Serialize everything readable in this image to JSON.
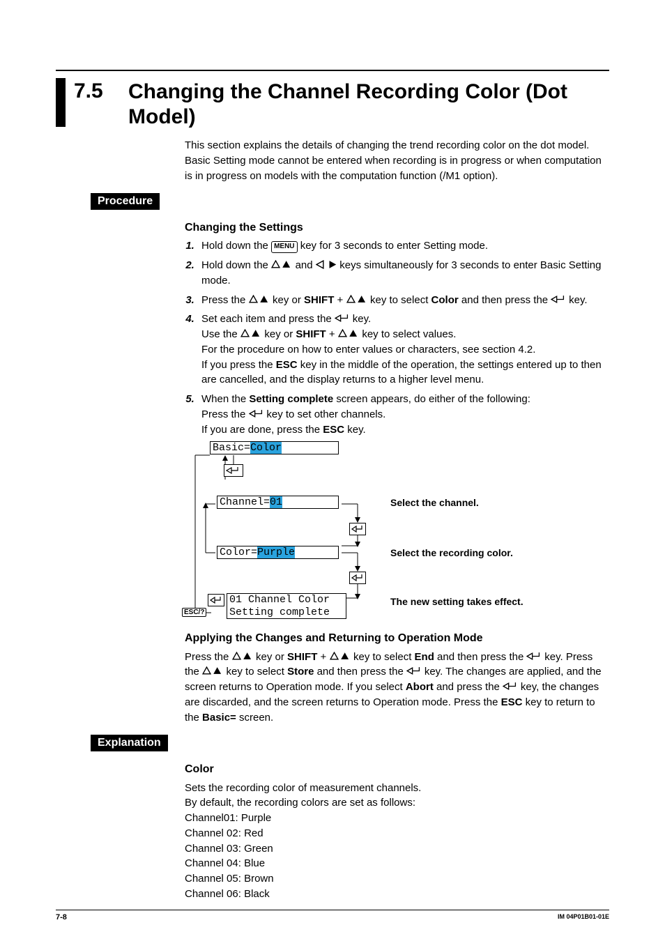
{
  "section_number": "7.5",
  "section_title": "Changing the Channel Recording Color (Dot Model)",
  "intro": "This section explains the details of changing the trend recording color on the dot model. Basic Setting mode cannot be entered when recording is in progress or when computation is in progress on models with the computation function (/M1 option).",
  "procedure_label": "Procedure",
  "changing_head": "Changing the Settings",
  "steps": {
    "s1_a": "Hold down the ",
    "s1_b": " key for 3 seconds to enter Setting mode.",
    "menu_key": "MENU",
    "s2_a": "Hold down the ",
    "s2_b": " and ",
    "s2_c": " keys simultaneously for 3 seconds to enter Basic Setting mode.",
    "s3_a": "Press the ",
    "s3_b": " key or ",
    "shift": "SHIFT",
    "s3_c": " + ",
    "s3_d": " key to select ",
    "color_word": "Color",
    "s3_e": " and then press the ",
    "s3_f": " key.",
    "s4_a": "Set each item and press the ",
    "s4_b": " key.",
    "s4_c": "Use the ",
    "s4_d": " key or ",
    "s4_e": " + ",
    "s4_f": " key to select values.",
    "s4_g": "For the procedure on how to enter values or characters, see section 4.2.",
    "s4_h1": "If you press the ",
    "esc": "ESC",
    "s4_h2": " key in the middle of the operation, the settings entered up to then are cancelled, and the display returns to a higher level menu.",
    "s5_a": "When the ",
    "setting_complete": "Setting complete",
    "s5_b": " screen appears, do either of the following:",
    "s5_c": "Press the ",
    "s5_d": " key to set other channels.",
    "s5_e": "If you are done, press the ",
    "s5_f": " key."
  },
  "flow": {
    "basic_label": "Basic=",
    "basic_val": "Color",
    "channel_label": "Channel=",
    "channel_val": "01",
    "color_label": "Color=",
    "color_val": "Purple",
    "result_l1": "01 Channel Color",
    "result_l2": "Setting complete",
    "cap_channel": "Select the channel.",
    "cap_color": "Select the recording color.",
    "cap_effect": "The new setting takes effect.",
    "esc_label": "ESC/?"
  },
  "apply_head": "Applying the Changes and Returning to Operation Mode",
  "apply": {
    "a1": "Press the ",
    "a2": " key or ",
    "a3": " + ",
    "a4": " key to select ",
    "end_word": "End",
    "a5": " and then press the ",
    "a6": " key. Press the ",
    "a7": " key to select ",
    "store_word": "Store",
    "a8": " and then press the ",
    "a9": " key. The changes are applied, and the screen returns to Operation mode. If you select ",
    "abort_word": "Abort",
    "a10": " and press the ",
    "a11": " key, the changes are discarded, and the screen returns to Operation mode. Press the ",
    "a12": " key to return to the ",
    "basic_eq": "Basic=",
    "a13": " screen."
  },
  "explanation_label": "Explanation",
  "color_head": "Color",
  "color_body1": "Sets the recording color of measurement channels.",
  "color_body2": "By default, the recording colors are set as follows:",
  "defaults": [
    "Channel01: Purple",
    "Channel 02: Red",
    "Channel 03: Green",
    "Channel 04: Blue",
    "Channel 05: Brown",
    "Channel 06: Black"
  ],
  "page_num": "7-8",
  "doc_id": "IM 04P01B01-01E"
}
